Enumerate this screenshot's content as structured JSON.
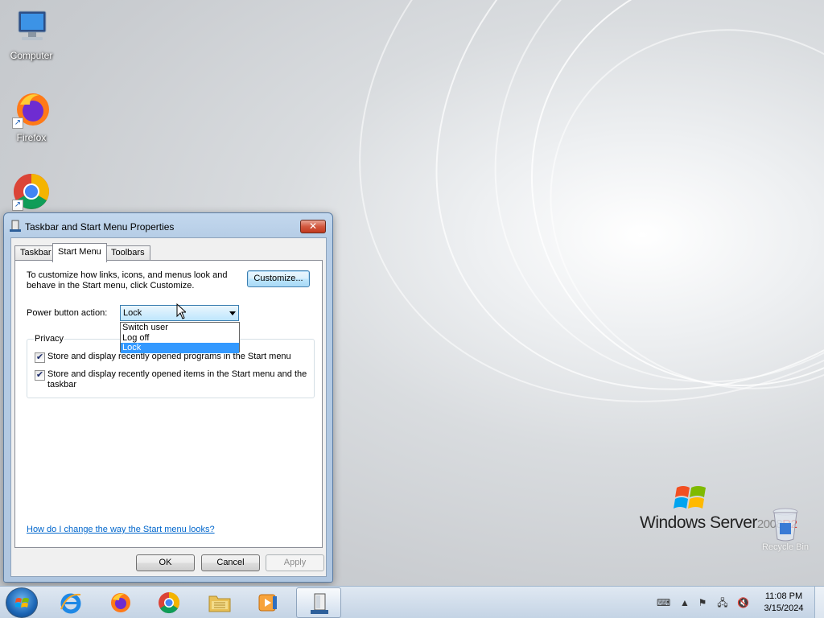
{
  "desktop": {
    "icons": [
      {
        "label": "Computer",
        "icon": "computer-icon"
      },
      {
        "label": "Firefox",
        "icon": "firefox-icon"
      },
      {
        "label": "",
        "icon": "chrome-icon"
      }
    ],
    "brand": {
      "text": "Windows Server",
      "version": "2008",
      "edition": "R2"
    },
    "recycle_bin": {
      "label": "Recycle Bin"
    }
  },
  "dialog": {
    "title": "Taskbar and Start Menu Properties",
    "close_label": "✕",
    "tabs": [
      {
        "label": "Taskbar",
        "active": false
      },
      {
        "label": "Start Menu",
        "active": true
      },
      {
        "label": "Toolbars",
        "active": false
      }
    ],
    "description": "To customize how links, icons, and menus look and behave in the Start menu, click Customize.",
    "customize_label": "Customize...",
    "power_label": "Power button action:",
    "power_value": "Lock",
    "power_options": [
      {
        "label": "Switch user",
        "selected": false
      },
      {
        "label": "Log off",
        "selected": false
      },
      {
        "label": "Lock",
        "selected": true
      }
    ],
    "privacy": {
      "title": "Privacy",
      "items": [
        {
          "label": "Store and display recently opened programs in the Start menu",
          "checked": true
        },
        {
          "label": "Store and display recently opened items in the Start menu and the taskbar",
          "checked": true
        }
      ]
    },
    "help_link": "How do I change the way the Start menu looks?",
    "buttons": {
      "ok": "OK",
      "cancel": "Cancel",
      "apply": "Apply"
    }
  },
  "taskbar": {
    "items": [
      {
        "name": "internet-explorer",
        "icon": "ie-icon",
        "active": false
      },
      {
        "name": "firefox",
        "icon": "firefox-icon",
        "active": false
      },
      {
        "name": "chrome",
        "icon": "chrome-icon",
        "active": false
      },
      {
        "name": "file-explorer",
        "icon": "folder-icon",
        "active": false
      },
      {
        "name": "media-player",
        "icon": "media-player-icon",
        "active": false
      },
      {
        "name": "taskbar-properties",
        "icon": "taskbar-properties-icon",
        "active": true
      }
    ],
    "clock": {
      "time": "11:08 PM",
      "date": "3/15/2024"
    }
  },
  "colors": {
    "selection": "#3399ff",
    "link": "#0066cc",
    "accent_red": "#d9342b"
  }
}
